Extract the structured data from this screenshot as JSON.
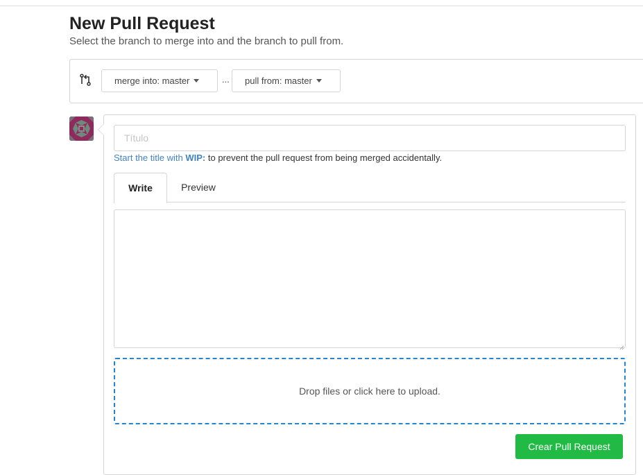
{
  "header": {
    "title": "New Pull Request",
    "subtitle": "Select the branch to merge into and the branch to pull from."
  },
  "branches": {
    "compare_icon": "git-compare-icon",
    "base_label": "merge into: master",
    "separator": "...",
    "head_label": "pull from: master"
  },
  "form": {
    "title_placeholder": "Título",
    "title_value": "",
    "wip_hint": {
      "lead": "Start the title with",
      "keyword": "WIP:",
      "rest": "to prevent the pull request from being merged accidentally."
    },
    "tabs": [
      {
        "label": "Write",
        "active": true
      },
      {
        "label": "Preview",
        "active": false
      }
    ],
    "body_value": "",
    "dropzone_text": "Drop files or click here to upload.",
    "submit_label": "Crear Pull Request"
  },
  "colors": {
    "link": "#4183c4",
    "dropzone_border": "#2185d0",
    "submit_bg": "#21ba45",
    "avatar_bg": "#8e2a5c"
  }
}
